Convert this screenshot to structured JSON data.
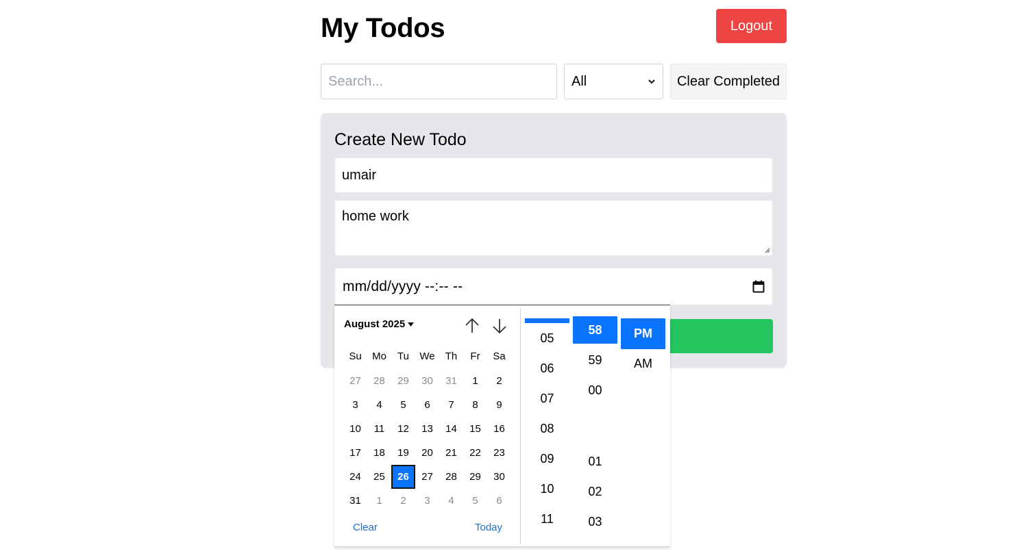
{
  "header": {
    "title": "My Todos",
    "logout_label": "Logout"
  },
  "toolbar": {
    "search_placeholder": "Search...",
    "search_value": "",
    "filter_selected": "All",
    "clear_completed_label": "Clear Completed"
  },
  "create_form": {
    "heading": "Create New Todo",
    "title_value": "umair",
    "description_value": "home work",
    "datetime_placeholder": "mm/dd/yyyy --:-- --"
  },
  "picker": {
    "month_label": "August 2025",
    "weekdays": [
      "Su",
      "Mo",
      "Tu",
      "We",
      "Th",
      "Fr",
      "Sa"
    ],
    "weeks": [
      [
        "27",
        "28",
        "29",
        "30",
        "31",
        "1",
        "2"
      ],
      [
        "3",
        "4",
        "5",
        "6",
        "7",
        "8",
        "9"
      ],
      [
        "10",
        "11",
        "12",
        "13",
        "14",
        "15",
        "16"
      ],
      [
        "17",
        "18",
        "19",
        "20",
        "21",
        "22",
        "23"
      ],
      [
        "24",
        "25",
        "26",
        "27",
        "28",
        "29",
        "30"
      ],
      [
        "31",
        "1",
        "2",
        "3",
        "4",
        "5",
        "6"
      ]
    ],
    "selected_day": "26",
    "clear_label": "Clear",
    "today_label": "Today",
    "hours": [
      "05",
      "06",
      "07",
      "08",
      "09",
      "10",
      "11"
    ],
    "minutes_top": [
      "58",
      "59",
      "00"
    ],
    "minutes_bottom": [
      "01",
      "02",
      "03"
    ],
    "selected_minute": "58",
    "meridiem": [
      "PM",
      "AM"
    ],
    "selected_meridiem": "PM"
  },
  "colors": {
    "logout_bg": "#ef4444",
    "submit_bg": "#22c55e",
    "panel_bg": "#e5e7eb",
    "accent_blue": "#0a74ff"
  }
}
